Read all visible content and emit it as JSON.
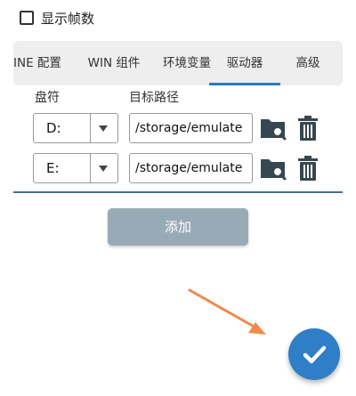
{
  "show_fps": {
    "label": "显示帧数",
    "checked": false
  },
  "tabs": [
    {
      "label": "INE 配置",
      "active": false
    },
    {
      "label": "WIN 组件",
      "active": false
    },
    {
      "label": "环境变量",
      "active": false
    },
    {
      "label": "驱动器",
      "active": true
    },
    {
      "label": "高级",
      "active": false
    }
  ],
  "columns": {
    "drive": "盘符",
    "target_path": "目标路径"
  },
  "drives": [
    {
      "letter": "D:",
      "path": "/storage/emulate"
    },
    {
      "letter": "E:",
      "path": "/storage/emulate"
    }
  ],
  "add_button": "添加",
  "icons": {
    "folder": "folder-search-icon",
    "trash": "trash-icon",
    "dropdown": "triangle-down-icon",
    "confirm": "check-icon"
  },
  "colors": {
    "accent": "#2b7bbb",
    "fab": "#2e7fc7",
    "button_disabled": "#98aab6",
    "annotation_arrow": "#f08a4b"
  }
}
